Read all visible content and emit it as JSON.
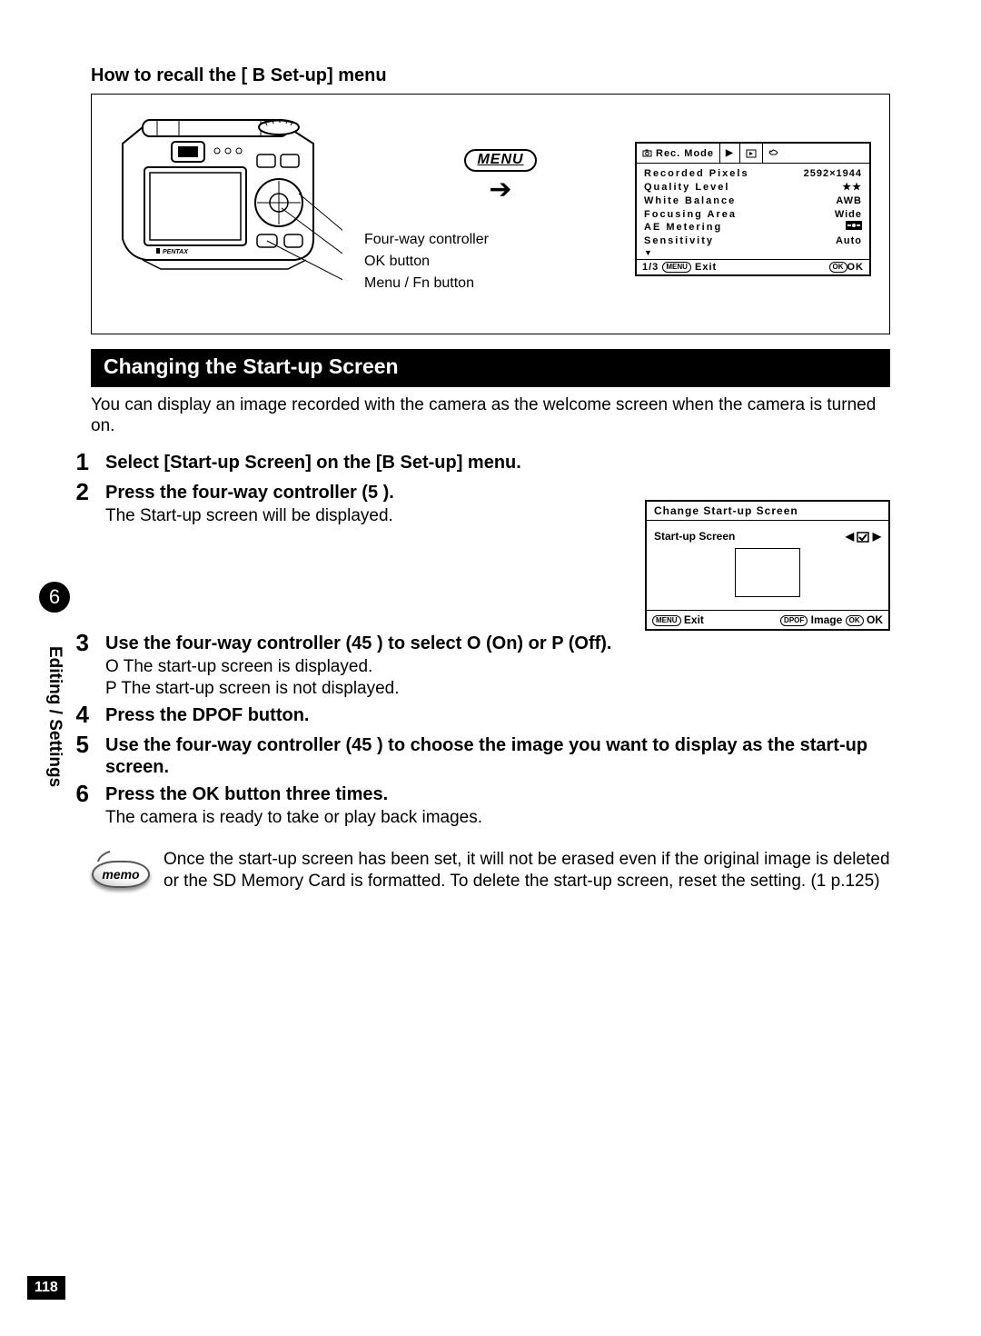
{
  "top_heading": "How to recall the [ B  Set-up] menu",
  "labels": {
    "menu_pill": "MENU",
    "four_way": "Four-way controller",
    "ok_btn": "OK button",
    "menu_fn": "Menu / Fn button"
  },
  "lcd": {
    "tab1": "Rec. Mode",
    "rows": {
      "recorded_pixels": {
        "k": "Recorded Pixels",
        "v": "2592×1944"
      },
      "quality": {
        "k": "Quality Level",
        "v": "★★"
      },
      "wb": {
        "k": "White Balance",
        "v": "AWB"
      },
      "focus": {
        "k": "Focusing Area",
        "v": "Wide"
      },
      "ae": {
        "k": "AE Metering",
        "v": ""
      },
      "sens": {
        "k": "Sensitivity",
        "v": "Auto"
      }
    },
    "footer_left": "1/3",
    "footer_exit": "Exit",
    "footer_menu": "MENU",
    "footer_ok": "OK",
    "footer_okpill": "OK"
  },
  "section_title": "Changing the Start-up Screen",
  "intro": "You can display an image recorded with the camera as the welcome screen when the camera is turned on.",
  "steps": {
    "s1": {
      "n": "1",
      "t": "Select [Start-up Screen] on the [B  Set-up] menu."
    },
    "s2": {
      "n": "2",
      "t": "Press the four-way controller (5  ).",
      "d": "The Start-up screen will be displayed."
    },
    "s3": {
      "n": "3",
      "t": "Use the four-way controller (45   ) to select O  (On) or P  (Off).",
      "d1": "O   The start-up screen is displayed.",
      "d2": "P   The start-up screen is not displayed."
    },
    "s4": {
      "n": "4",
      "t": "Press the DPOF button."
    },
    "s5": {
      "n": "5",
      "t": "Use the four-way controller (45   ) to choose the image you want to display as the start-up screen."
    },
    "s6": {
      "n": "6",
      "t": "Press the OK button three times.",
      "d": "The camera is ready to take or play back images."
    }
  },
  "right_lcd": {
    "title": "Change Start-up Screen",
    "row_label": "Start-up Screen",
    "menu": "MENU",
    "exit": "Exit",
    "dpof": "DPOF",
    "image": "Image",
    "okpill": "OK",
    "ok": "OK"
  },
  "memo": {
    "label": "memo",
    "text": "Once the start-up screen has been set, it will not be erased even if the original image is deleted or the SD Memory Card  is formatted. To delete the start-up screen, reset the setting. (1  p.125)"
  },
  "side": {
    "chapter": "6",
    "label": "Editing / Settings"
  },
  "page_number": "118"
}
